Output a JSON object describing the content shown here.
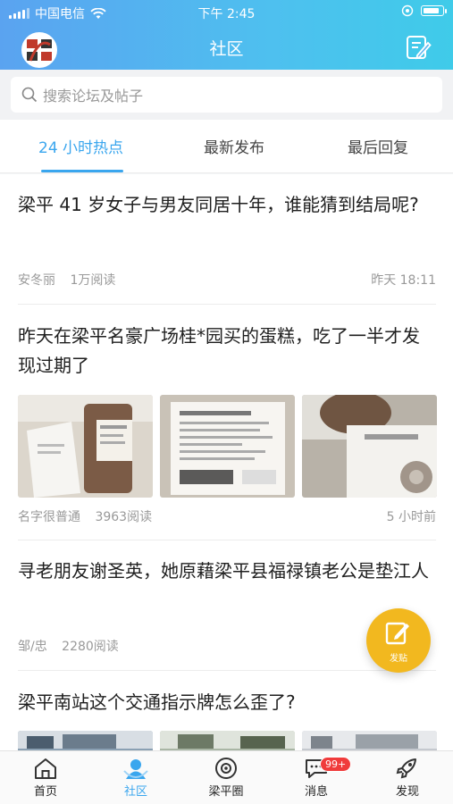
{
  "status_bar": {
    "carrier": "中国电信",
    "time": "下午 2:45"
  },
  "nav": {
    "title": "社区"
  },
  "search": {
    "placeholder": "搜索论坛及帖子"
  },
  "tabs": [
    {
      "label": "24 小时热点",
      "active": true
    },
    {
      "label": "最新发布",
      "active": false
    },
    {
      "label": "最后回复",
      "active": false
    }
  ],
  "posts": [
    {
      "title": "梁平 41 岁女子与男友同居十年，谁能猜到结局呢?",
      "author": "安冬丽",
      "reads": "1万阅读",
      "time": "昨天 18:11"
    },
    {
      "title": "昨天在梁平名豪广场桂*园买的蛋糕，吃了一半才发现过期了",
      "author": "名字很普通",
      "reads": "3963阅读",
      "time": "5 小时前"
    },
    {
      "title": "寻老朋友谢圣英，她原藉梁平县福禄镇老公是垫江人",
      "author": "邹/忠",
      "reads": "2280阅读",
      "time": ""
    },
    {
      "title": "梁平南站这个交通指示牌怎么歪了?",
      "author": "",
      "reads": "",
      "time": ""
    }
  ],
  "fab": {
    "label": "发贴"
  },
  "tabbar": [
    {
      "label": "首页",
      "icon": "home-icon"
    },
    {
      "label": "社区",
      "icon": "community-icon",
      "active": true
    },
    {
      "label": "梁平圈",
      "icon": "circle-icon"
    },
    {
      "label": "消息",
      "icon": "message-icon",
      "badge": "99+"
    },
    {
      "label": "发现",
      "icon": "rocket-icon"
    }
  ],
  "colors": {
    "accent": "#3aa6ee",
    "fab": "#f2b81f",
    "badge": "#f03b3b"
  }
}
